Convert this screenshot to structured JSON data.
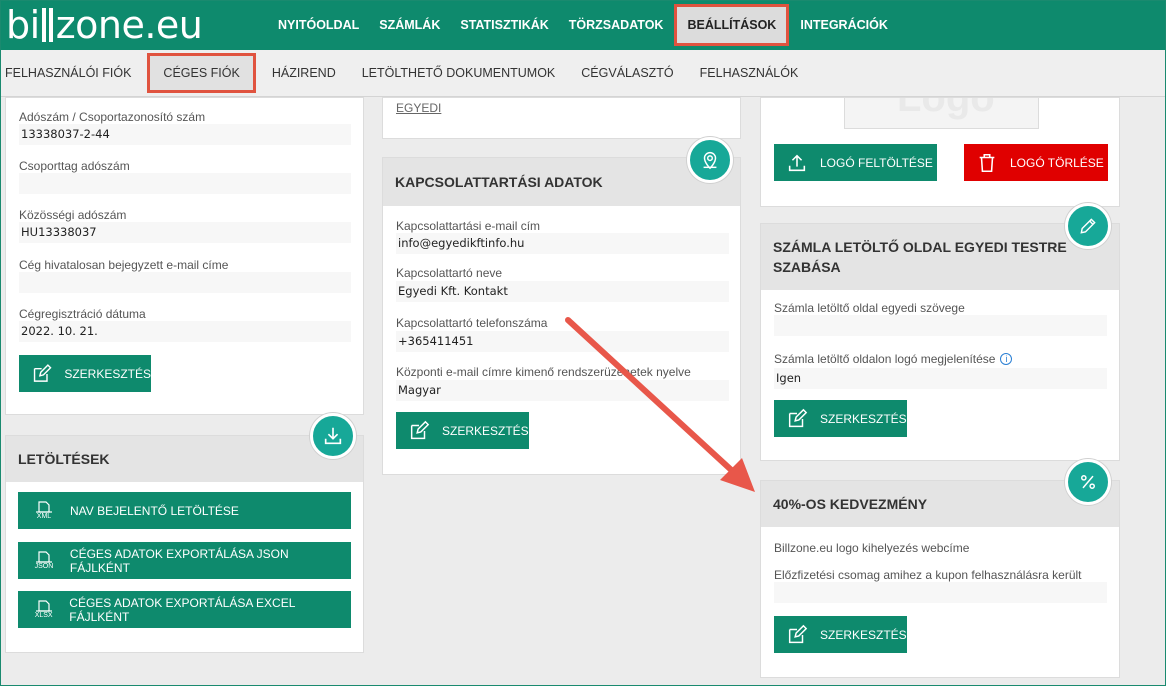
{
  "brand": {
    "logo_left": "bi",
    "logo_right": "zone.eu"
  },
  "topnav": [
    "NYITÓOLDAL",
    "SZÁMLÁK",
    "STATISZTIKÁK",
    "TÖRZSADATOK",
    "BEÁLLÍTÁSOK",
    "INTEGRÁCIÓK"
  ],
  "subnav": [
    "FELHASZNÁLÓI FIÓK",
    "CÉGES FIÓK",
    "HÁZIREND",
    "LETÖLTHETŐ DOKUMENTUMOK",
    "CÉGVÁLASZTÓ",
    "FELHASZNÁLÓK"
  ],
  "company_panel": {
    "fields": [
      {
        "label": "Adószám / Csoportazonosító szám",
        "value": "13338037-2-44"
      },
      {
        "label": "Csoporttag adószám",
        "value": ""
      },
      {
        "label": "Közösségi adószám",
        "value": "HU13338037"
      },
      {
        "label": "Cég hivatalosan bejegyzett e-mail címe",
        "value": ""
      },
      {
        "label": "Cégregisztráció dátuma",
        "value": "2022. 10. 21."
      }
    ],
    "edit_label": "SZERKESZTÉS"
  },
  "downloads": {
    "title": "LETÖLTÉSEK",
    "buttons": [
      {
        "label": "NAV BEJELENTŐ LETÖLTÉSE",
        "tag": "XML"
      },
      {
        "label": "CÉGES ADATOK EXPORTÁLÁSA JSON FÁJLKÉNT",
        "tag": "JSON"
      },
      {
        "label": "CÉGES ADATOK EXPORTÁLÁSA EXCEL FÁJLKÉNT",
        "tag": "XLSX"
      }
    ]
  },
  "middle_top": {
    "link": "EGYEDI"
  },
  "contact_panel": {
    "title": "KAPCSOLATTARTÁSI ADATOK",
    "fields": [
      {
        "label": "Kapcsolattartási e-mail cím",
        "value": "info@egyedikftinfo.hu"
      },
      {
        "label": "Kapcsolattartó neve",
        "value": "Egyedi Kft. Kontakt"
      },
      {
        "label": "Kapcsolattartó telefonszáma",
        "value": "+365411451"
      },
      {
        "label": "Központi e-mail címre kimenő rendszerüzenetek nyelve",
        "value": "Magyar"
      }
    ],
    "edit_label": "SZERKESZTÉS"
  },
  "logo_panel": {
    "placeholder": "Logo",
    "upload_label": "LOGÓ FELTÖLTÉSE",
    "delete_label": "LOGÓ TÖRLÉSE"
  },
  "invoice_page_panel": {
    "title": "SZÁMLA LETÖLTŐ OLDAL EGYEDI TESTRE SZABÁSA",
    "fields": [
      {
        "label": "Számla letöltő oldal egyedi szövege",
        "value": ""
      },
      {
        "label": "Számla letöltő oldalon logó megjelenítése",
        "value": "Igen"
      }
    ],
    "edit_label": "SZERKESZTÉS"
  },
  "discount_panel": {
    "title": "40%-OS KEDVEZMÉNY",
    "fields": [
      {
        "label": "Billzone.eu logo kihelyezés webcíme"
      },
      {
        "label": "Előzfizetési csomag amihez a kupon felhasználásra került",
        "value": ""
      }
    ],
    "edit_label": "SZERKESZTÉS"
  },
  "colors": {
    "brand_green": "#0e8a6d",
    "teal": "#17a898",
    "danger": "#e00000",
    "highlight": "#e0533f",
    "arrow": "#e8574a"
  }
}
